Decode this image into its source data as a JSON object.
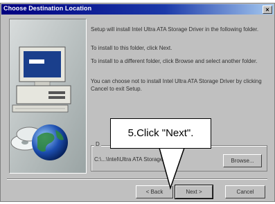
{
  "window": {
    "title": "Choose Destination Location",
    "close_symbol": "×"
  },
  "body": {
    "paragraph1": "Setup will install Intel Ultra ATA Storage Driver in the following folder.",
    "paragraph2": "To install to this folder, click Next.",
    "paragraph3": "To install to a different folder, click Browse and select another folder.",
    "paragraph4": "You can choose not to install Intel Ultra ATA Storage Driver by clicking Cancel to exit Setup."
  },
  "destination": {
    "label": "D",
    "path": "C:\\...\\Intel\\Ultra ATA Storage",
    "browse_label": "Browse..."
  },
  "buttons": {
    "back_label": "< Back",
    "next_label": "Next >",
    "cancel_label": "Cancel"
  },
  "callout": {
    "text": "5.Click \"Next\"."
  },
  "colors": {
    "title_start": "#000080",
    "title_end": "#a6caf0",
    "face": "#c0c0c0"
  },
  "icons": [
    "computer-icon",
    "globe-icon",
    "cd-icon",
    "close-icon"
  ]
}
